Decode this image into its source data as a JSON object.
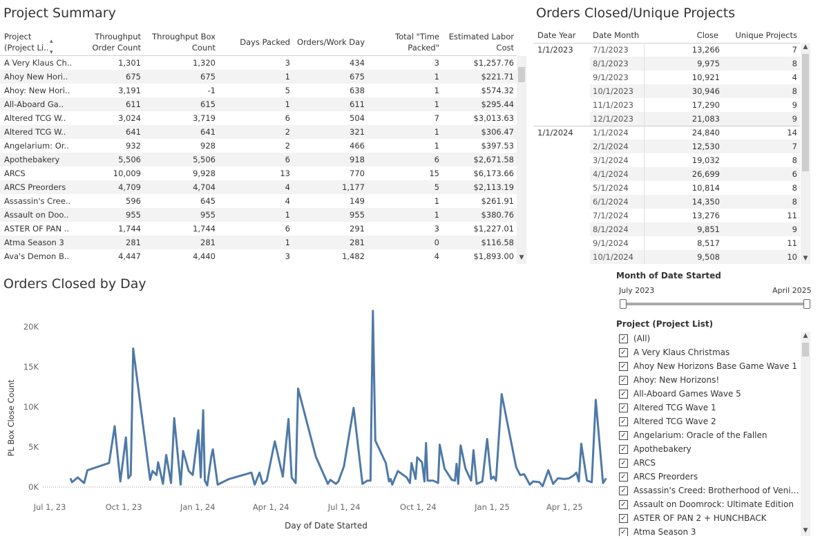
{
  "project_summary": {
    "title": "Project Summary",
    "headers": {
      "project": "Project",
      "project_sub": "(Project Li..",
      "sort_icon": "sort-indicator",
      "throughput_order": "Throughput",
      "throughput_order_sub": "Order Count",
      "throughput_box": "Throughput Box",
      "throughput_box_sub": "Count",
      "days_packed": "Days Packed",
      "orders_work_day": "Orders/Work Day",
      "total_time": "Total \"Time",
      "total_time_sub": "Packed\"",
      "est_labor": "Estimated Labor",
      "est_labor_sub": "Cost"
    },
    "rows": [
      [
        "A Very Klaus Ch..",
        "1,301",
        "1,320",
        "3",
        "434",
        "3",
        "$1,257.76"
      ],
      [
        "Ahoy New Hori..",
        "675",
        "675",
        "1",
        "675",
        "1",
        "$221.71"
      ],
      [
        "Ahoy: New Hori..",
        "3,191",
        "-1",
        "5",
        "638",
        "1",
        "$574.32"
      ],
      [
        "All-Aboard Ga..",
        "611",
        "615",
        "1",
        "611",
        "1",
        "$295.44"
      ],
      [
        "Altered TCG W..",
        "3,024",
        "3,719",
        "6",
        "504",
        "7",
        "$3,013.63"
      ],
      [
        "Altered TCG W..",
        "641",
        "641",
        "2",
        "321",
        "1",
        "$306.47"
      ],
      [
        "Angelarium: Or..",
        "932",
        "928",
        "2",
        "466",
        "1",
        "$397.53"
      ],
      [
        "Apothebakery",
        "5,506",
        "5,506",
        "6",
        "918",
        "6",
        "$2,671.58"
      ],
      [
        "ARCS",
        "10,009",
        "9,928",
        "13",
        "770",
        "15",
        "$6,173.66"
      ],
      [
        "ARCS Preorders",
        "4,709",
        "4,704",
        "4",
        "1,177",
        "5",
        "$2,113.19"
      ],
      [
        "Assassin's Cree..",
        "596",
        "645",
        "4",
        "149",
        "1",
        "$261.91"
      ],
      [
        "Assault on Doo..",
        "955",
        "955",
        "1",
        "955",
        "1",
        "$380.76"
      ],
      [
        "ASTER OF PAN ..",
        "1,744",
        "1,744",
        "6",
        "291",
        "3",
        "$1,227.01"
      ],
      [
        "Atma Season 3",
        "281",
        "281",
        "1",
        "281",
        "0",
        "$116.58"
      ],
      [
        "Ava's Demon B..",
        "4,447",
        "4,440",
        "3",
        "1,482",
        "4",
        "$1,893.00"
      ]
    ]
  },
  "orders_unique": {
    "title": "Orders Closed/Unique Projects",
    "headers": {
      "date_year": "Date Year",
      "date_month": "Date Month",
      "close": "Close",
      "unique": "Unique Projects"
    },
    "groups": [
      {
        "year": "1/1/2023",
        "rows": [
          [
            "7/1/2023",
            "13,266",
            "7"
          ],
          [
            "8/1/2023",
            "9,975",
            "8"
          ],
          [
            "9/1/2023",
            "10,921",
            "4"
          ],
          [
            "10/1/2023",
            "30,946",
            "8"
          ],
          [
            "11/1/2023",
            "17,290",
            "9"
          ],
          [
            "12/1/2023",
            "21,083",
            "9"
          ]
        ]
      },
      {
        "year": "1/1/2024",
        "rows": [
          [
            "1/1/2024",
            "24,840",
            "14"
          ],
          [
            "2/1/2024",
            "12,530",
            "7"
          ],
          [
            "3/1/2024",
            "19,032",
            "8"
          ],
          [
            "4/1/2024",
            "26,699",
            "6"
          ],
          [
            "5/1/2024",
            "10,814",
            "8"
          ],
          [
            "6/1/2024",
            "14,350",
            "8"
          ],
          [
            "7/1/2024",
            "13,276",
            "11"
          ],
          [
            "8/1/2024",
            "9,851",
            "9"
          ],
          [
            "9/1/2024",
            "8,517",
            "11"
          ],
          [
            "10/1/2024",
            "9,508",
            "10"
          ]
        ]
      }
    ]
  },
  "chart_title": "Orders Closed by Day",
  "chart_data": {
    "type": "line",
    "xlabel": "Day of Date Started",
    "ylabel": "PL Box Close Count",
    "x_tick_labels": [
      "Jul 1, 23",
      "Oct 1, 23",
      "Jan 1, 24",
      "Apr 1, 24",
      "Jul 1, 24",
      "Oct 1, 24",
      "Jan 1, 25",
      "Apr 1, 25"
    ],
    "y_tick_labels": [
      "0K",
      "5K",
      "10K",
      "15K",
      "20K"
    ],
    "ylim": [
      0,
      22000
    ],
    "x_start": "2023-07-01",
    "x_end": "2025-05-12",
    "color": "#4e79a7",
    "series": [
      {
        "values": [
          [
            "2023-07-01",
            1100
          ],
          [
            "2023-07-03",
            600
          ],
          [
            "2023-07-10",
            1200
          ],
          [
            "2023-07-18",
            500
          ],
          [
            "2023-07-22",
            2100
          ],
          [
            "2023-08-18",
            3000
          ],
          [
            "2023-08-25",
            7600
          ],
          [
            "2023-09-01",
            700
          ],
          [
            "2023-09-08",
            6200
          ],
          [
            "2023-09-11",
            1100
          ],
          [
            "2023-09-14",
            1500
          ],
          [
            "2023-09-17",
            17300
          ],
          [
            "2023-10-08",
            900
          ],
          [
            "2023-10-11",
            2000
          ],
          [
            "2023-10-16",
            1500
          ],
          [
            "2023-10-18",
            3100
          ],
          [
            "2023-10-24",
            400
          ],
          [
            "2023-10-28",
            4000
          ],
          [
            "2023-11-03",
            500
          ],
          [
            "2023-11-07",
            8600
          ],
          [
            "2023-11-15",
            300
          ],
          [
            "2023-11-18",
            4500
          ],
          [
            "2023-11-25",
            2000
          ],
          [
            "2023-11-30",
            1500
          ],
          [
            "2023-12-07",
            7100
          ],
          [
            "2023-12-10",
            1200
          ],
          [
            "2023-12-13",
            9600
          ],
          [
            "2023-12-15",
            800
          ],
          [
            "2023-12-18",
            200
          ],
          [
            "2023-12-23",
            3800
          ],
          [
            "2023-12-25",
            4700
          ],
          [
            "2023-12-31",
            300
          ],
          [
            "2024-01-14",
            1000
          ],
          [
            "2024-02-11",
            1800
          ],
          [
            "2024-02-15",
            300
          ],
          [
            "2024-02-21",
            1800
          ],
          [
            "2024-02-25",
            400
          ],
          [
            "2024-03-01",
            800
          ],
          [
            "2024-03-11",
            5700
          ],
          [
            "2024-03-21",
            1300
          ],
          [
            "2024-03-28",
            8500
          ],
          [
            "2024-04-01",
            1200
          ],
          [
            "2024-04-06",
            500
          ],
          [
            "2024-04-09",
            12300
          ],
          [
            "2024-05-01",
            3800
          ],
          [
            "2024-05-16",
            400
          ],
          [
            "2024-05-19",
            900
          ],
          [
            "2024-05-26",
            400
          ],
          [
            "2024-05-29",
            700
          ],
          [
            "2024-06-05",
            2600
          ],
          [
            "2024-06-17",
            9900
          ],
          [
            "2024-06-28",
            400
          ],
          [
            "2024-07-04",
            800
          ],
          [
            "2024-07-08",
            800
          ],
          [
            "2024-07-11",
            22000
          ],
          [
            "2024-07-14",
            5800
          ],
          [
            "2024-07-27",
            3000
          ],
          [
            "2024-07-31",
            700
          ],
          [
            "2024-08-02",
            1000
          ],
          [
            "2024-08-04",
            300
          ],
          [
            "2024-08-11",
            2000
          ],
          [
            "2024-08-22",
            1200
          ],
          [
            "2024-08-26",
            500
          ],
          [
            "2024-08-28",
            3000
          ],
          [
            "2024-09-02",
            1000
          ],
          [
            "2024-09-04",
            3700
          ],
          [
            "2024-09-10",
            3100
          ],
          [
            "2024-09-13",
            700
          ],
          [
            "2024-09-15",
            5500
          ],
          [
            "2024-09-17",
            800
          ],
          [
            "2024-09-24",
            800
          ],
          [
            "2024-09-30",
            500
          ],
          [
            "2024-10-02",
            5300
          ],
          [
            "2024-10-08",
            2300
          ],
          [
            "2024-10-17",
            900
          ],
          [
            "2024-10-21",
            800
          ],
          [
            "2024-10-23",
            2900
          ],
          [
            "2024-10-25",
            400
          ],
          [
            "2024-10-28",
            5200
          ],
          [
            "2024-11-03",
            2300
          ],
          [
            "2024-11-10",
            800
          ],
          [
            "2024-11-13",
            4600
          ],
          [
            "2024-11-17",
            400
          ],
          [
            "2024-11-24",
            700
          ],
          [
            "2024-11-30",
            6000
          ],
          [
            "2024-12-05",
            1000
          ],
          [
            "2024-12-08",
            1300
          ],
          [
            "2024-12-11",
            800
          ],
          [
            "2024-12-18",
            11600
          ],
          [
            "2025-01-05",
            2500
          ],
          [
            "2025-01-10",
            1500
          ],
          [
            "2025-01-15",
            1600
          ],
          [
            "2025-01-22",
            300
          ],
          [
            "2025-01-26",
            700
          ],
          [
            "2025-02-03",
            600
          ],
          [
            "2025-02-07",
            100
          ],
          [
            "2025-02-14",
            2100
          ],
          [
            "2025-02-20",
            400
          ],
          [
            "2025-02-26",
            1100
          ],
          [
            "2025-03-06",
            1000
          ],
          [
            "2025-03-12",
            1100
          ],
          [
            "2025-03-18",
            1500
          ],
          [
            "2025-03-21",
            1800
          ],
          [
            "2025-03-24",
            700
          ],
          [
            "2025-03-27",
            5400
          ],
          [
            "2025-04-03",
            800
          ],
          [
            "2025-04-09",
            600
          ],
          [
            "2025-04-14",
            10900
          ],
          [
            "2025-04-23",
            500
          ],
          [
            "2025-04-27",
            1100
          ]
        ]
      }
    ]
  },
  "filters": {
    "date_title": "Month of Date Started",
    "date_min": "July 2023",
    "date_max": "April 2025",
    "project_title": "Project (Project List)",
    "items": [
      "(All)",
      "A Very Klaus Christmas",
      "Ahoy New Horizons Base Game Wave 1",
      "Ahoy: New Horizons!",
      "All-Aboard Games Wave 5",
      "Altered TCG Wave 1",
      "Altered TCG Wave 2",
      "Angelarium: Oracle of the Fallen",
      "Apothebakery",
      "ARCS",
      "ARCS Preorders",
      "Assassin's Creed: Brotherhood of Venice ...",
      "Assault on Doomrock: Ultimate Edition",
      "ASTER OF PAN 2 + HUNCHBACK",
      "Atma Season 3"
    ],
    "check_mark": "✓"
  }
}
